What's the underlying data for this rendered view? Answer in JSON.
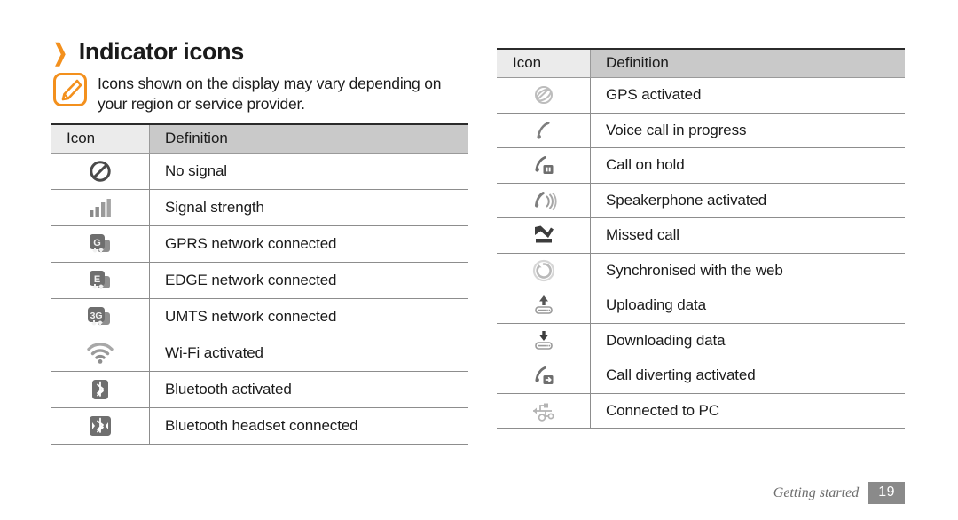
{
  "heading": {
    "chevron": "❯",
    "title": "Indicator icons"
  },
  "note": {
    "icon": "note-pencil-icon",
    "text": "Icons shown on the display may vary depending on your region or service provider."
  },
  "colors": {
    "accent_orange": "#F3901D",
    "header_icon_bg": "#EBEBEB",
    "header_def_bg": "#C9C9C9",
    "rule": "#8D8D8D",
    "top_rule": "#2B2B2B",
    "footer_badge_bg": "#8A8A8A",
    "footer_text": "#6D6D6D"
  },
  "table_left": {
    "headers": {
      "icon": "Icon",
      "definition": "Definition"
    },
    "rows": [
      {
        "icon": "no-signal-icon",
        "definition": "No signal"
      },
      {
        "icon": "signal-strength-icon",
        "definition": "Signal strength"
      },
      {
        "icon": "gprs-network-icon",
        "definition": "GPRS network connected"
      },
      {
        "icon": "edge-network-icon",
        "definition": "EDGE network connected"
      },
      {
        "icon": "umts-network-icon",
        "definition": "UMTS network connected"
      },
      {
        "icon": "wifi-activated-icon",
        "definition": "Wi-Fi activated"
      },
      {
        "icon": "bluetooth-activated-icon",
        "definition": "Bluetooth activated"
      },
      {
        "icon": "bluetooth-headset-icon",
        "definition": "Bluetooth headset connected"
      }
    ]
  },
  "table_right": {
    "headers": {
      "icon": "Icon",
      "definition": "Definition"
    },
    "rows": [
      {
        "icon": "gps-activated-icon",
        "definition": "GPS activated"
      },
      {
        "icon": "voice-call-icon",
        "definition": "Voice call in progress"
      },
      {
        "icon": "call-on-hold-icon",
        "definition": "Call on hold"
      },
      {
        "icon": "speakerphone-icon",
        "definition": "Speakerphone activated"
      },
      {
        "icon": "missed-call-icon",
        "definition": "Missed call"
      },
      {
        "icon": "sync-web-icon",
        "definition": "Synchronised with the web"
      },
      {
        "icon": "upload-data-icon",
        "definition": "Uploading data"
      },
      {
        "icon": "download-data-icon",
        "definition": "Downloading data"
      },
      {
        "icon": "call-diverting-icon",
        "definition": "Call diverting activated"
      },
      {
        "icon": "connected-to-pc-icon",
        "definition": "Connected to PC"
      }
    ]
  },
  "footer": {
    "section": "Getting started",
    "page": "19"
  }
}
